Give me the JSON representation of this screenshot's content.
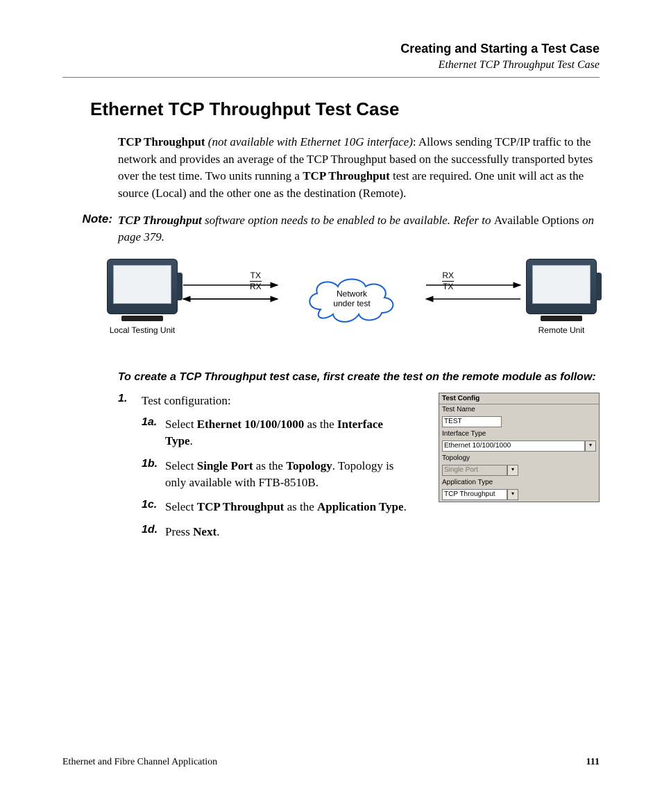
{
  "header": {
    "chapter": "Creating and Starting a Test Case",
    "section": "Ethernet TCP Throughput Test Case"
  },
  "title": "Ethernet TCP Throughput Test Case",
  "intro": {
    "lead_bold": "TCP Throughput",
    "lead_italic": " (not available with Ethernet 10G interface)",
    "rest1": ": Allows sending TCP/IP traffic to the network and provides an average of the TCP Throughput based on the successfully transported bytes over the test time. Two units running a ",
    "mid_bold": "TCP Throughput",
    "rest2": " test are required. One unit will act as the source (Local) and the other one as the destination (Remote)."
  },
  "note": {
    "label": "Note:",
    "bi": "TCP Throughput",
    "it1": " software option needs to be enabled to be available. Refer to ",
    "plain": "Available Options",
    "it2": " on page 379."
  },
  "diagram": {
    "left_label": "Local Testing Unit",
    "right_label": "Remote Unit",
    "cloud_line1": "Network",
    "cloud_line2": "under test",
    "tx": "TX",
    "rx": "RX"
  },
  "instr_lead": "To create a TCP Throughput test case, first create the test on the remote module as follow:",
  "steps": {
    "s1_num": "1.",
    "s1_txt": "Test configuration:",
    "s1a_num": "1a.",
    "s1a_pre": "Select ",
    "s1a_b1": "Ethernet 10/100/1000",
    "s1a_mid": " as the ",
    "s1a_b2": "Interface Type",
    "s1a_post": ".",
    "s1b_num": "1b.",
    "s1b_pre": "Select ",
    "s1b_b1": "Single Port",
    "s1b_mid": " as the ",
    "s1b_b2": "Topology",
    "s1b_post": ". Topology is only available with FTB-8510B.",
    "s1c_num": "1c.",
    "s1c_pre": "Select ",
    "s1c_b1": "TCP Throughput",
    "s1c_mid": " as the ",
    "s1c_b2": "Application Type",
    "s1c_post": ".",
    "s1d_num": "1d.",
    "s1d_pre": "Press ",
    "s1d_b1": "Next",
    "s1d_post": "."
  },
  "config": {
    "header": "Test Config",
    "name_label": "Test Name",
    "name_value": "TEST",
    "iface_label": "Interface Type",
    "iface_value": "Ethernet 10/100/1000",
    "topo_label": "Topology",
    "topo_value": "Single Port",
    "app_label": "Application Type",
    "app_value": "TCP Throughput"
  },
  "footer": {
    "doc": "Ethernet and Fibre Channel Application",
    "page": "111"
  }
}
